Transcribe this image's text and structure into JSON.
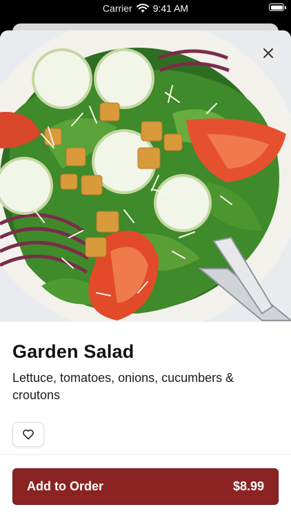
{
  "status_bar": {
    "carrier": "Carrier",
    "time": "9:41 AM"
  },
  "item": {
    "title": "Garden Salad",
    "description": "Lettuce, tomatoes, onions, cucumbers & croutons"
  },
  "actions": {
    "add_label": "Add to Order",
    "price": "$8.99"
  },
  "icons": {
    "close": "close-icon",
    "favorite": "heart-outline-icon",
    "wifi": "wifi-icon",
    "battery": "battery-icon"
  },
  "colors": {
    "accent": "#8b2322",
    "text": "#111111",
    "background": "#ffffff"
  }
}
